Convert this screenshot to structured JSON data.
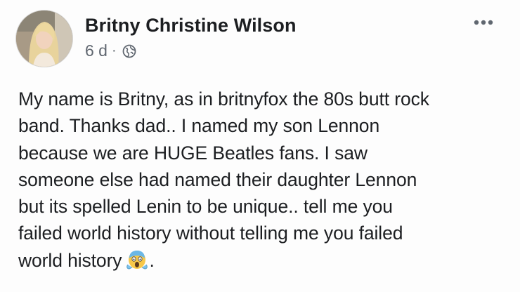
{
  "post": {
    "author": "Britny Christine Wilson",
    "time": "6 d",
    "separator": "·",
    "privacy_icon": "globe-icon",
    "menu_icon": "more-options-icon",
    "body_lines": [
      "My name is Britny, as in britnyfox the 80s butt rock",
      "band. Thanks dad.. I named my son Lennon",
      "because we are HUGE Beatles fans. I saw",
      "someone else had named their daughter Lennon",
      "but its spelled Lenin to be unique.. tell me you",
      "failed world history without telling me you failed",
      "world history"
    ],
    "body_end": ".",
    "emoji": "screaming-face-emoji"
  }
}
